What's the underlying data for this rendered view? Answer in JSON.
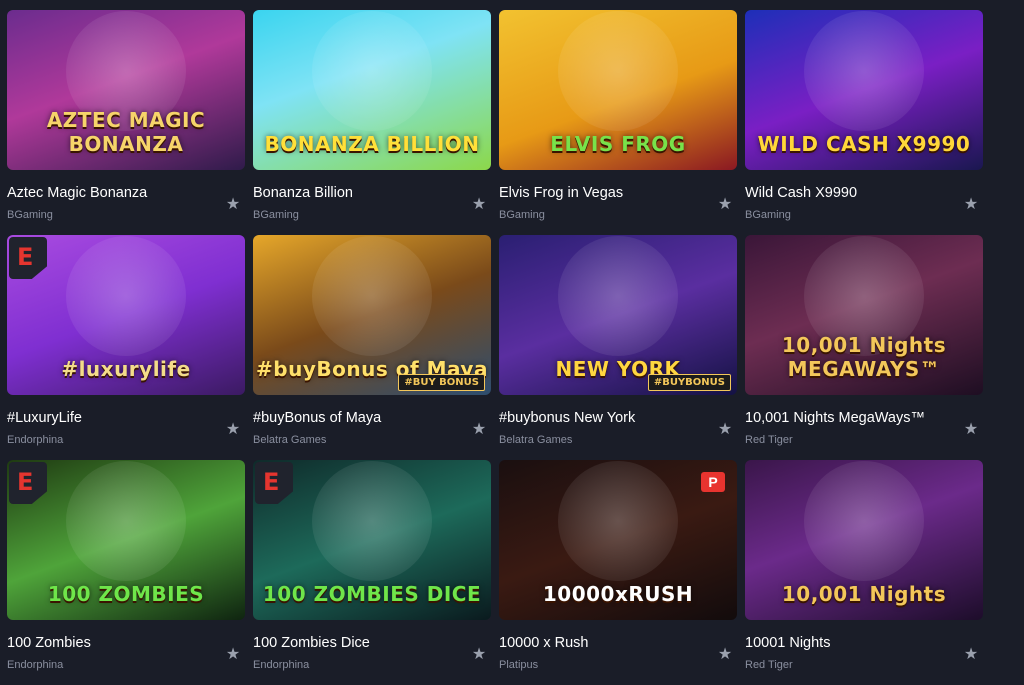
{
  "games": [
    {
      "title": "Aztec Magic Bonanza",
      "provider": "BGaming",
      "logo": "AZTEC MAGIC BONANZA",
      "icon": "aztec-magic-bonanza-thumbnail",
      "bg": "linear-gradient(160deg,#6b2c8e 0%,#b0399a 45%,#2f1b4a 100%)",
      "logo_color": "#f6d46a"
    },
    {
      "title": "Bonanza Billion",
      "provider": "BGaming",
      "logo": "BONANZA BILLION",
      "icon": "bonanza-billion-thumbnail",
      "bg": "linear-gradient(160deg,#3ad4ef 0%,#7fe3f5 40%,#8cd84a 100%)",
      "logo_color": "#ffe03a"
    },
    {
      "title": "Elvis Frog in Vegas",
      "provider": "BGaming",
      "logo": "ELVIS FROG",
      "icon": "elvis-frog-thumbnail",
      "bg": "linear-gradient(160deg,#f2c230 0%,#e79a16 55%,#8a1822 100%)",
      "logo_color": "#78e24a"
    },
    {
      "title": "Wild Cash X9990",
      "provider": "BGaming",
      "logo": "WILD CASH X9990",
      "icon": "wild-cash-thumbnail",
      "bg": "linear-gradient(160deg,#1d2fb8 0%,#7a1fc4 50%,#1a1750 100%)",
      "logo_color": "#ffd73a"
    },
    {
      "title": "#LuxuryLife",
      "provider": "Endorphina",
      "logo": "#luxurylife",
      "icon": "luxurylife-thumbnail",
      "bg": "linear-gradient(160deg,#a94be0 0%,#7f2fd1 50%,#3b1a62 100%)",
      "logo_color": "#f3dc8a",
      "badge": "E"
    },
    {
      "title": "#buyBonus of Maya",
      "provider": "Belatra Games",
      "logo": "#buyBonus of Maya",
      "icon": "buybonus-maya-thumbnail",
      "bg": "linear-gradient(160deg,#e6a72a 0%,#7a4a1a 50%,#2d4d6f 100%)",
      "logo_color": "#ffe06a",
      "tag": "#BUY BONUS"
    },
    {
      "title": "#buybonus New York",
      "provider": "Belatra Games",
      "logo": "NEW YORK",
      "icon": "buybonus-new-york-thumbnail",
      "bg": "linear-gradient(160deg,#2a1f72 0%,#5a2ea0 50%,#141243 100%)",
      "logo_color": "#ffd640",
      "tag": "#BUYBONUS"
    },
    {
      "title": "10,001 Nights MegaWays™",
      "provider": "Red Tiger",
      "logo": "10,001 Nights MEGAWAYS™",
      "icon": "10001-nights-megaways-thumbnail",
      "bg": "linear-gradient(160deg,#3a1638 0%,#6d2d52 45%,#1e0e22 100%)",
      "logo_color": "#f3c75a"
    },
    {
      "title": "100 Zombies",
      "provider": "Endorphina",
      "logo": "100 ZOMBIES",
      "icon": "100-zombies-thumbnail",
      "bg": "linear-gradient(160deg,#1f3a12 0%,#4fa43a 50%,#0f2410 100%)",
      "logo_color": "#6fe64a",
      "badge": "E"
    },
    {
      "title": "100 Zombies Dice",
      "provider": "Endorphina",
      "logo": "100 ZOMBIES DICE",
      "icon": "100-zombies-dice-thumbnail",
      "bg": "linear-gradient(160deg,#0f2a2a 0%,#1d6a5a 50%,#0a1a1e 100%)",
      "logo_color": "#6fe64a",
      "badge": "E"
    },
    {
      "title": "10000 x Rush",
      "provider": "Platipus",
      "logo": "10000xRUSH",
      "icon": "10000-x-rush-thumbnail",
      "bg": "linear-gradient(160deg,#1a0f10 0%,#3a1a12 50%,#120b0c 100%)",
      "logo_color": "#ffffff",
      "badge_p": "P"
    },
    {
      "title": "10001 Nights",
      "provider": "Red Tiger",
      "logo": "10,001 Nights",
      "icon": "10001-nights-thumbnail",
      "bg": "linear-gradient(160deg,#3a164a 0%,#6b2a8a 45%,#1d0d2a 100%)",
      "logo_color": "#f3c75a"
    }
  ],
  "favorite_icon": "star-icon"
}
